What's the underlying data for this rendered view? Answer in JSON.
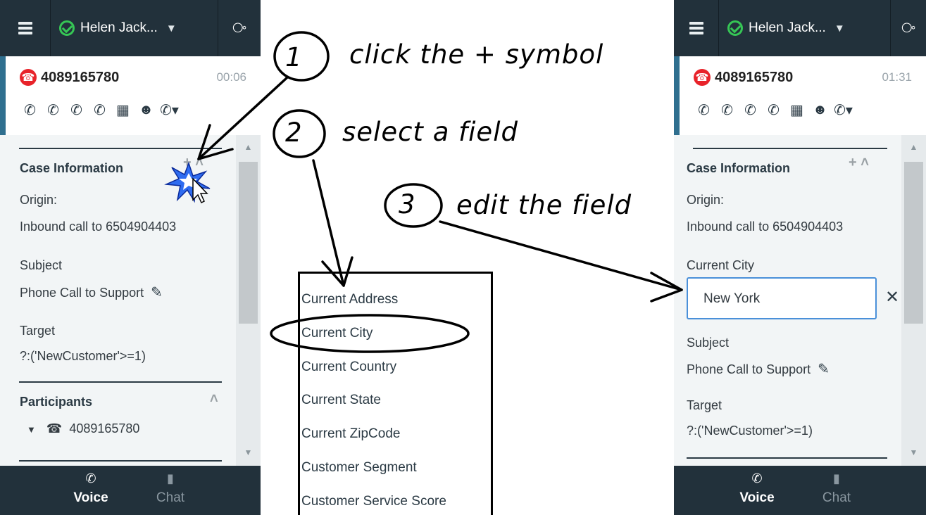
{
  "panels": [
    {
      "agent_name": "Helen Jack...",
      "phone": "4089165780",
      "timer": "00:06",
      "case_title": "Case Information",
      "origin_label": "Origin:",
      "origin_value": "Inbound call to 6504904403",
      "subject_label": "Subject",
      "subject_value": "Phone Call to Support",
      "target_label": "Target",
      "target_value": "?:('NewCustomer'>=1)",
      "participants_title": "Participants",
      "participant_phone": "4089165780",
      "tab_voice": "Voice",
      "tab_chat": "Chat"
    },
    {
      "agent_name": "Helen Jack...",
      "phone": "4089165780",
      "timer": "01:31",
      "case_title": "Case Information",
      "origin_label": "Origin:",
      "origin_value": "Inbound call to 6504904403",
      "city_label": "Current City",
      "city_value": "New York",
      "subject_label": "Subject",
      "subject_value": "Phone Call to Support",
      "target_label": "Target",
      "target_value": "?:('NewCustomer'>=1)",
      "tab_voice": "Voice",
      "tab_chat": "Chat"
    }
  ],
  "callouts": {
    "step1_number": "1",
    "step1_text": "click the + symbol",
    "step2_number": "2",
    "step2_text": "select a field",
    "step3_number": "3",
    "step3_text": "edit the field"
  },
  "field_list": [
    "Current Address",
    "Current City",
    "Current Country",
    "Current State",
    "Current ZipCode",
    "Customer Segment",
    "Customer Service Score"
  ],
  "icons": {
    "menu": "hamburger-icon",
    "status": "check-circle-icon",
    "support": "lifebuoy-icon",
    "call_badge": "phone-incoming-icon",
    "toolbar": [
      "end-call-icon",
      "hold-icon",
      "transfer-icon",
      "conference-icon",
      "keypad-icon",
      "consult-icon",
      "more-call-actions-icon"
    ],
    "edit": "pencil-icon",
    "clear": "close-icon"
  },
  "colors": {
    "topbar": "#22313b",
    "panel_bg": "#f2f5f6",
    "status_green": "#36c655",
    "call_red": "#e8232a",
    "accent_border": "#2f6f8f",
    "input_focus": "#4a90d9"
  }
}
